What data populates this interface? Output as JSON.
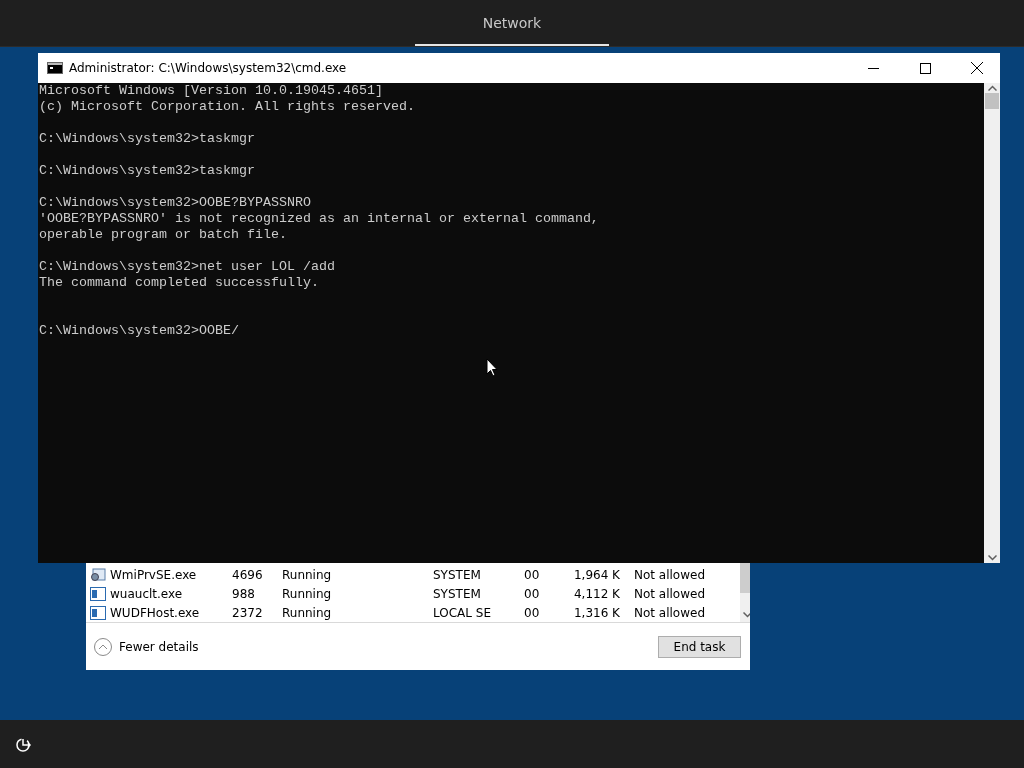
{
  "top_bar": {
    "tabs": [
      {
        "label": "Network",
        "selected": true
      }
    ]
  },
  "console_window": {
    "title": "Administrator: C:\\Windows\\system32\\cmd.exe",
    "blocks": [
      {
        "kind": "first",
        "lines": [
          "Microsoft Windows [Version 10.0.19045.4651]",
          "(c) Microsoft Corporation. All rights reserved."
        ]
      },
      {
        "kind": "normal",
        "lines": [
          "C:\\Windows\\system32>taskmgr"
        ]
      },
      {
        "kind": "normal",
        "lines": [
          "C:\\Windows\\system32>taskmgr"
        ]
      },
      {
        "kind": "normal",
        "lines": [
          "C:\\Windows\\system32>OOBE?BYPASSNRO",
          "'OOBE?BYPASSNRO' is not recognized as an internal or external command,",
          "operable program or batch file."
        ]
      },
      {
        "kind": "normal",
        "lines": [
          "C:\\Windows\\system32>net user LOL /add",
          "The command completed successfully."
        ]
      },
      {
        "kind": "wide_gap",
        "lines": [
          "C:\\Windows\\system32>OOBE/"
        ]
      }
    ]
  },
  "task_manager": {
    "rows": [
      {
        "kind": "service",
        "name": "WmiPrvSE.exe",
        "pid": "4696",
        "status": "Running",
        "user": "SYSTEM",
        "cpu": "00",
        "memory": "1,964 K",
        "uac": "Not allowed"
      },
      {
        "kind": "app",
        "name": "wuauclt.exe",
        "pid": "988",
        "status": "Running",
        "user": "SYSTEM",
        "cpu": "00",
        "memory": "4,112 K",
        "uac": "Not allowed"
      },
      {
        "kind": "app",
        "name": "WUDFHost.exe",
        "pid": "2372",
        "status": "Running",
        "user": "LOCAL SE",
        "cpu": "00",
        "memory": "1,316 K",
        "uac": "Not allowed"
      }
    ],
    "fewer_details": "Fewer details",
    "end_task": "End task"
  }
}
